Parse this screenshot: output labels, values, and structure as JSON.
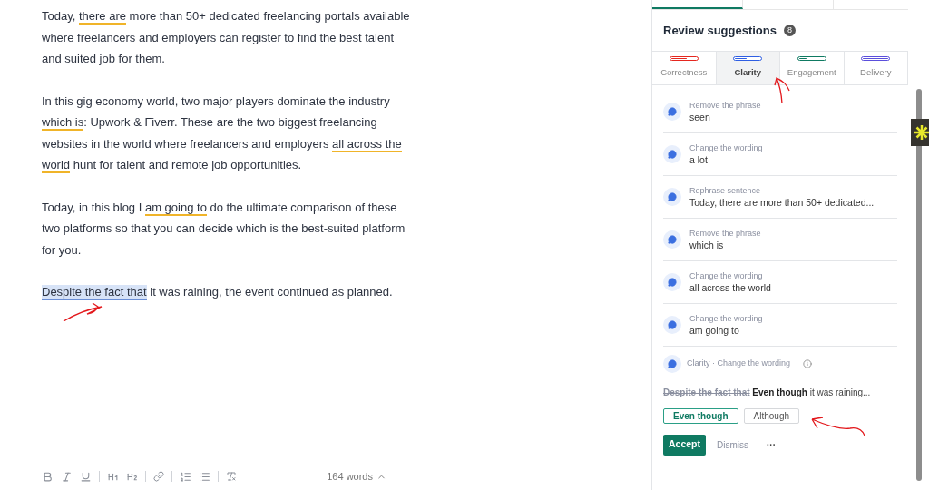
{
  "editor": {
    "paragraphs": [
      [
        {
          "text": "Today, ",
          "underlined": false,
          "selected": false
        },
        {
          "text": "there are",
          "underlined": true,
          "selected": false
        },
        {
          "text": " more than 50+ dedicated freelancing portals available where freelancers and employers can register to find the best talent and suited job for them.",
          "underlined": false,
          "selected": false
        }
      ],
      [
        {
          "text": "In this gig economy world, two major players dominate the industry ",
          "underlined": false,
          "selected": false
        },
        {
          "text": "which is",
          "underlined": true,
          "selected": false
        },
        {
          "text": ": Upwork & Fiverr. These are the two biggest freelancing websites in the world where freelancers and employers ",
          "underlined": false,
          "selected": false
        },
        {
          "text": "all across the world",
          "underlined": true,
          "selected": false
        },
        {
          "text": " hunt for talent and remote job opportunities.",
          "underlined": false,
          "selected": false
        }
      ],
      [
        {
          "text": "Today, in this blog I ",
          "underlined": false,
          "selected": false
        },
        {
          "text": "am going to",
          "underlined": true,
          "selected": false
        },
        {
          "text": " do the ultimate comparison of these two platforms so that you can decide which is the best-suited platform for you.",
          "underlined": false,
          "selected": false
        }
      ],
      [
        {
          "text": "Despite the fact that",
          "underlined": true,
          "selected": true
        },
        {
          "text": " it was raining, the event continued as planned.",
          "underlined": false,
          "selected": false
        }
      ]
    ],
    "word_count": "164 words"
  },
  "panel": {
    "title": "Review suggestions",
    "count": "8",
    "categories": [
      {
        "label": "Correctness",
        "color": "#e5271f",
        "level": 0.6,
        "selected": false
      },
      {
        "label": "Clarity",
        "color": "#2f5fe3",
        "level": 0.45,
        "selected": true
      },
      {
        "label": "Engagement",
        "color": "#0f7a62",
        "level": 0.3,
        "selected": false
      },
      {
        "label": "Delivery",
        "color": "#5b4fdc",
        "level": 1,
        "selected": false
      }
    ],
    "suggestions": [
      {
        "type": "Remove the phrase",
        "text": "seen"
      },
      {
        "type": "Change the wording",
        "text": "a lot"
      },
      {
        "type": "Rephrase sentence",
        "text": "Today, there are more than 50+ dedicated..."
      },
      {
        "type": "Remove the phrase",
        "text": "which is"
      },
      {
        "type": "Change the wording",
        "text": "all across the world"
      },
      {
        "type": "Change the wording",
        "text": "am going to"
      }
    ],
    "active_card": {
      "header": "Clarity · Change the wording",
      "removed": "Despite the fact that",
      "inserted": "Even though",
      "rest": "it was raining...",
      "options": [
        {
          "label": "Even though",
          "selected": true
        },
        {
          "label": "Although",
          "selected": false
        }
      ],
      "accept": "Accept",
      "dismiss": "Dismiss",
      "more": "···"
    }
  }
}
